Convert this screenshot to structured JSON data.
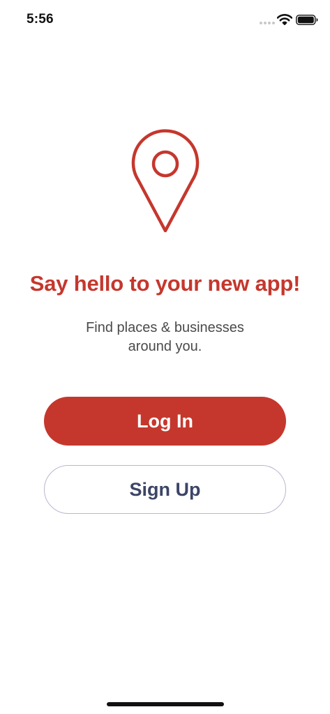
{
  "status_bar": {
    "time": "5:56",
    "icons": [
      "signal-dots-icon",
      "wifi-icon",
      "battery-icon"
    ]
  },
  "hero": {
    "icon": "location-pin-icon",
    "headline": "Say hello to your new app!",
    "subtitle_line1": "Find places & businesses",
    "subtitle_line2": "around you."
  },
  "actions": {
    "login_label": "Log In",
    "signup_label": "Sign Up"
  },
  "colors": {
    "brand": "#c5372d",
    "secondary_text": "#3d4566",
    "body_text": "#4a4a4a",
    "outline": "#b9b6cf"
  }
}
